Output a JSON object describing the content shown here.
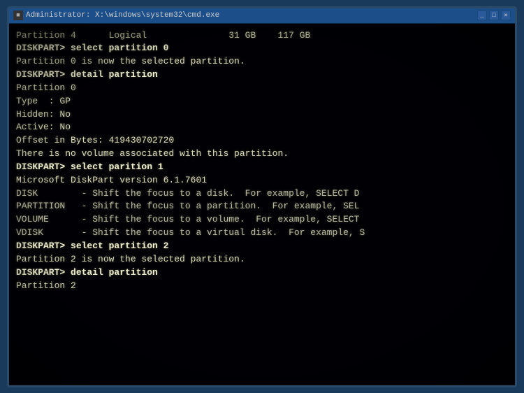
{
  "window": {
    "title": "Administrator: X:\\windows\\system32\\cmd.exe",
    "title_short": "Administrator X:\\windows\\system32\\cmd.exe"
  },
  "terminal": {
    "lines": [
      {
        "type": "table",
        "text": "Partition 4      Logical               31 GB    117 GB"
      },
      {
        "type": "cmd",
        "text": "DISKPART> select partition 0"
      },
      {
        "type": "output",
        "text": ""
      },
      {
        "type": "output",
        "text": "Partition 0 is now the selected partition."
      },
      {
        "type": "output",
        "text": ""
      },
      {
        "type": "cmd",
        "text": "DISKPART> detail partition"
      },
      {
        "type": "output",
        "text": ""
      },
      {
        "type": "output",
        "text": "Partition 0"
      },
      {
        "type": "output",
        "text": "Type  : GP"
      },
      {
        "type": "output",
        "text": "Hidden: No"
      },
      {
        "type": "output",
        "text": "Active: No"
      },
      {
        "type": "output",
        "text": "Offset in Bytes: 419430702720"
      },
      {
        "type": "output",
        "text": ""
      },
      {
        "type": "output",
        "text": "There is no volume associated with this partition."
      },
      {
        "type": "output",
        "text": ""
      },
      {
        "type": "cmd",
        "text": "DISKPART> select parition 1"
      },
      {
        "type": "output",
        "text": ""
      },
      {
        "type": "output",
        "text": "Microsoft DiskPart version 6.1.7601"
      },
      {
        "type": "output",
        "text": ""
      },
      {
        "type": "help",
        "text": "DISK        - Shift the focus to a disk.  For example, SELECT D"
      },
      {
        "type": "help",
        "text": "PARTITION   - Shift the focus to a partition.  For example, SEL"
      },
      {
        "type": "help",
        "text": "VOLUME      - Shift the focus to a volume.  For example, SELECT"
      },
      {
        "type": "help",
        "text": "VDISK       - Shift the focus to a virtual disk.  For example, S"
      },
      {
        "type": "output",
        "text": ""
      },
      {
        "type": "cmd",
        "text": "DISKPART> select partition 2"
      },
      {
        "type": "output",
        "text": ""
      },
      {
        "type": "output",
        "text": "Partition 2 is now the selected partition."
      },
      {
        "type": "output",
        "text": ""
      },
      {
        "type": "cmd",
        "text": "DISKPART> detail partition"
      },
      {
        "type": "output",
        "text": ""
      },
      {
        "type": "output",
        "text": "Partition 2"
      }
    ]
  },
  "colors": {
    "bg": "#000005",
    "text_normal": "#d8d8b8",
    "text_cmd": "#f0f0d0",
    "text_help": "#b8b8a0",
    "text_table": "#c0c0a0",
    "titlebar": "#1c4f8a"
  }
}
